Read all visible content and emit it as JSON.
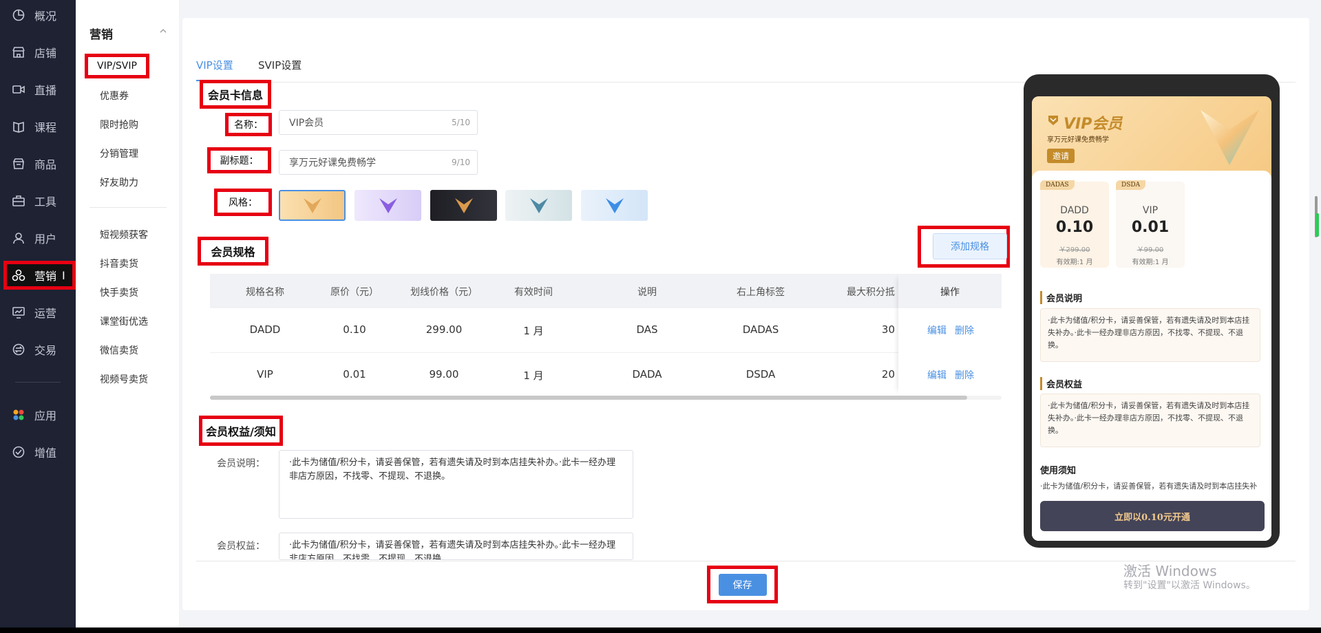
{
  "sidebar": {
    "items": [
      {
        "label": "概况",
        "icon": "chart-pie-icon"
      },
      {
        "label": "店铺",
        "icon": "store-icon"
      },
      {
        "label": "直播",
        "icon": "video-camera-icon"
      },
      {
        "label": "课程",
        "icon": "book-icon"
      },
      {
        "label": "商品",
        "icon": "shop-bag-icon"
      },
      {
        "label": "工具",
        "icon": "toolbox-icon"
      },
      {
        "label": "用户",
        "icon": "user-icon"
      },
      {
        "label": "营销",
        "icon": "marketing-icon"
      },
      {
        "label": "运营",
        "icon": "operation-chart-icon"
      },
      {
        "label": "交易",
        "icon": "exchange-icon"
      }
    ],
    "extra": [
      {
        "label": "应用",
        "icon": "apps-icon"
      },
      {
        "label": "增值",
        "icon": "value-added-icon"
      }
    ]
  },
  "submenu": {
    "title": "营销",
    "items": [
      "VIP/SVIP",
      "优惠券",
      "限时抢购",
      "分销管理",
      "好友助力"
    ],
    "items2": [
      "短视频获客",
      "抖音卖货",
      "快手卖货",
      "课堂街优选",
      "微信卖货",
      "视频号卖货"
    ]
  },
  "tabs": [
    "VIP设置",
    "SVIP设置"
  ],
  "card_info": {
    "section_title": "会员卡信息",
    "name_label": "名称：",
    "name_value": "VIP会员",
    "name_count": "5/10",
    "subtitle_label": "副标题：",
    "subtitle_value": "享万元好课免费畅学",
    "subtitle_count": "9/10",
    "style_label": "风格："
  },
  "spec": {
    "section_title": "会员规格",
    "add_button": "添加规格",
    "headers": [
      "规格名称",
      "原价（元）",
      "划线价格（元）",
      "有效时间",
      "说明",
      "右上角标签",
      "最大积分抵",
      "操作"
    ],
    "rows": [
      {
        "name": "DADD",
        "price": "0.10",
        "strike": "299.00",
        "valid": "1 月",
        "desc": "DAS",
        "tag": "DADAS",
        "points": "30"
      },
      {
        "name": "VIP",
        "price": "0.01",
        "strike": "99.00",
        "valid": "1 月",
        "desc": "DADA",
        "tag": "DSDA",
        "points": "20"
      }
    ],
    "edit": "编辑",
    "delete": "删除"
  },
  "rights": {
    "section_title": "会员权益/须知",
    "desc_label": "会员说明：",
    "desc_text": "·此卡为储值/积分卡，请妥善保管，若有遗失请及时到本店挂失补办。·此卡一经办理非店方原因，不找零、不提现、不退换。",
    "rights_label": "会员权益：",
    "rights_text": "·此卡为储值/积分卡，请妥善保管，若有遗失请及时到本店挂失补办。·此卡一经办理非店方原因，不找零、不提现、不退换。"
  },
  "save_button": "保存",
  "preview": {
    "title": "VIP会员",
    "subtitle": "享万元好课免费畅学",
    "invite": "邀请",
    "cards": [
      {
        "tag": "DADAS",
        "name": "DADD",
        "price": "0.10",
        "old": "￥299.00",
        "valid": "有效期:1 月"
      },
      {
        "tag": "DSDA",
        "name": "VIP",
        "price": "0.01",
        "old": "￥99.00",
        "valid": "有效期:1 月"
      }
    ],
    "sec1": "会员说明",
    "sec1_text": "·此卡为储值/积分卡，请妥善保管，若有遗失请及时到本店挂失补办。·此卡一经办理非店方原因，不找零、不提现、不退换。",
    "sec2": "会员权益",
    "sec2_text": "·此卡为储值/积分卡，请妥善保管，若有遗失请及时到本店挂失补办。·此卡一经办理非店方原因，不找零、不提现、不退换。",
    "sec3": "使用须知",
    "sec3_text": "·此卡为储值/积分卡，请妥善保管，若有遗失请及时到本店挂失补办。·此卡一经办理非店方原因，不找零、不提现、不退换。",
    "open_button": "立即以0.10元开通"
  },
  "watermark": {
    "line1": "激活 Windows",
    "line2": "转到\"设置\"以激活 Windows。"
  },
  "colors": {
    "accent": "#4a90e2",
    "sidebar": "#1e2233",
    "highlight": "#e60012",
    "gold": "#c48b2a"
  }
}
